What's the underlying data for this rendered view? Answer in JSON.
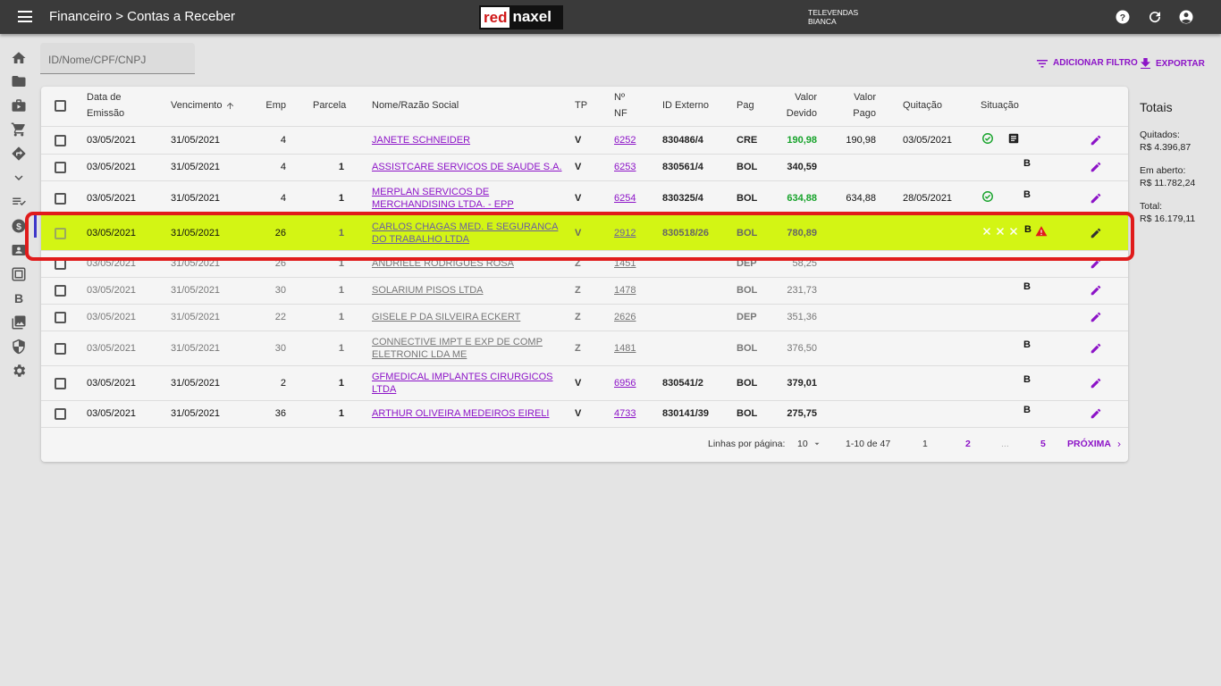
{
  "header": {
    "breadcrumb": "Financeiro > Contas a Receber",
    "logo_red": "red",
    "logo_white": "naxel",
    "user_line1": "TELEVENDAS",
    "user_line2": "BIANCA"
  },
  "search": {
    "placeholder": "ID/Nome/CPF/CNPJ",
    "value": ""
  },
  "actions": {
    "add_filter": "ADICIONAR FILTRO",
    "export": "EXPORTAR"
  },
  "columns": {
    "data_emissao_1": "Data de",
    "data_emissao_2": "Emissão",
    "vencimento": "Vencimento",
    "emp": "Emp",
    "parcela": "Parcela",
    "nome": "Nome/Razão Social",
    "tp": "TP",
    "nf_1": "Nº",
    "nf_2": "NF",
    "id_externo": "ID Externo",
    "pag": "Pag",
    "valor_devido_1": "Valor",
    "valor_devido_2": "Devido",
    "valor_pago_1": "Valor",
    "valor_pago_2": "Pago",
    "quitacao": "Quitação",
    "situacao": "Situação"
  },
  "rows": [
    {
      "emissao": "03/05/2021",
      "vencimento": "31/05/2021",
      "emp": "4",
      "parcela": "",
      "nome1": "JANETE SCHNEIDER",
      "nome2": "",
      "tp": "V",
      "nf": "6252",
      "id_externo": "830486/4",
      "pag": "CRE",
      "valor_devido": "190,98",
      "valor_pago": "190,98",
      "quitacao": "03/05/2021",
      "situacao": "check,doc"
    },
    {
      "emissao": "03/05/2021",
      "vencimento": "31/05/2021",
      "emp": "4",
      "parcela": "1",
      "nome1": "ASSISTCARE SERVICOS DE SAUDE S.A.",
      "nome2": "",
      "tp": "V",
      "nf": "6253",
      "id_externo": "830561/4",
      "pag": "BOL",
      "valor_devido": "340,59",
      "valor_pago": "",
      "quitacao": "",
      "situacao": "B"
    },
    {
      "emissao": "03/05/2021",
      "vencimento": "31/05/2021",
      "emp": "4",
      "parcela": "1",
      "nome1": "MERPLAN SERVICOS DE",
      "nome2": "MERCHANDISING LTDA. - EPP",
      "tp": "V",
      "nf": "6254",
      "id_externo": "830325/4",
      "pag": "BOL",
      "valor_devido": "634,88",
      "valor_pago": "634,88",
      "quitacao": "28/05/2021",
      "situacao": "check,B"
    },
    {
      "emissao": "03/05/2021",
      "vencimento": "31/05/2021",
      "emp": "26",
      "parcela": "1",
      "nome1": "CARLOS CHAGAS MED. E SEGURANCA",
      "nome2": "DO TRABALHO LTDA",
      "tp": "V",
      "nf": "2912",
      "id_externo": "830518/26",
      "pag": "BOL",
      "valor_devido": "780,89",
      "valor_pago": "",
      "quitacao": "",
      "situacao": "xxx,B,warn"
    },
    {
      "emissao": "03/05/2021",
      "vencimento": "31/05/2021",
      "emp": "26",
      "parcela": "1",
      "nome1": "ANDRIELE RODRIGUES ROSA",
      "nome2": "",
      "tp": "Z",
      "nf": "1451",
      "id_externo": "",
      "pag": "DEP",
      "valor_devido": "58,25",
      "valor_pago": "",
      "quitacao": "",
      "situacao": ""
    },
    {
      "emissao": "03/05/2021",
      "vencimento": "31/05/2021",
      "emp": "30",
      "parcela": "1",
      "nome1": "SOLARIUM PISOS LTDA",
      "nome2": "",
      "tp": "Z",
      "nf": "1478",
      "id_externo": "",
      "pag": "BOL",
      "valor_devido": "231,73",
      "valor_pago": "",
      "quitacao": "",
      "situacao": "B"
    },
    {
      "emissao": "03/05/2021",
      "vencimento": "31/05/2021",
      "emp": "22",
      "parcela": "1",
      "nome1": "GISELE P DA SILVEIRA ECKERT",
      "nome2": "",
      "tp": "Z",
      "nf": "2626",
      "id_externo": "",
      "pag": "DEP",
      "valor_devido": "351,36",
      "valor_pago": "",
      "quitacao": "",
      "situacao": ""
    },
    {
      "emissao": "03/05/2021",
      "vencimento": "31/05/2021",
      "emp": "30",
      "parcela": "1",
      "nome1": "CONNECTIVE IMPT E EXP DE COMP",
      "nome2": "ELETRONIC LDA ME",
      "tp": "Z",
      "nf": "1481",
      "id_externo": "",
      "pag": "BOL",
      "valor_devido": "376,50",
      "valor_pago": "",
      "quitacao": "",
      "situacao": "B"
    },
    {
      "emissao": "03/05/2021",
      "vencimento": "31/05/2021",
      "emp": "2",
      "parcela": "1",
      "nome1": "GFMEDICAL IMPLANTES CIRURGICOS",
      "nome2": "LTDA",
      "tp": "V",
      "nf": "6956",
      "id_externo": "830541/2",
      "pag": "BOL",
      "valor_devido": "379,01",
      "valor_pago": "",
      "quitacao": "",
      "situacao": "B"
    },
    {
      "emissao": "03/05/2021",
      "vencimento": "31/05/2021",
      "emp": "36",
      "parcela": "1",
      "nome1": "ARTHUR OLIVEIRA MEDEIROS EIRELI",
      "nome2": "",
      "tp": "V",
      "nf": "4733",
      "id_externo": "830141/39",
      "pag": "BOL",
      "valor_devido": "275,75",
      "valor_pago": "",
      "quitacao": "",
      "situacao": "B"
    }
  ],
  "pagination": {
    "rows_label": "Linhas por página:",
    "rows_value": "10",
    "range": "1-10 de 47",
    "p1": "1",
    "p2": "2",
    "ellipsis": "...",
    "p5": "5",
    "next": "PRÓXIMA"
  },
  "totais": {
    "title": "Totais",
    "quitados_label": "Quitados:",
    "quitados_value": "R$ 4.396,87",
    "aberto_label": "Em aberto:",
    "aberto_value": "R$ 11.782,24",
    "total_label": "Total:",
    "total_value": "R$ 16.179,11"
  },
  "colors": {
    "accent": "#8c13c7",
    "highlight": "#d3f514",
    "success": "#17a32b",
    "alert": "#e01b1b"
  },
  "icons": [
    "menu-icon",
    "help-icon",
    "refresh-icon",
    "account-icon",
    "home-icon",
    "folder-icon",
    "briefcase-icon",
    "cart-icon",
    "directions-icon",
    "chevron-down-icon",
    "list-check-icon",
    "money-icon",
    "contact-card-icon",
    "calculator-icon",
    "bold-b-icon",
    "image-icon",
    "shield-icon",
    "gear-icon",
    "filter-icon",
    "download-icon",
    "edit-icon",
    "check-circle-icon",
    "document-icon",
    "warning-icon",
    "close-icon"
  ]
}
